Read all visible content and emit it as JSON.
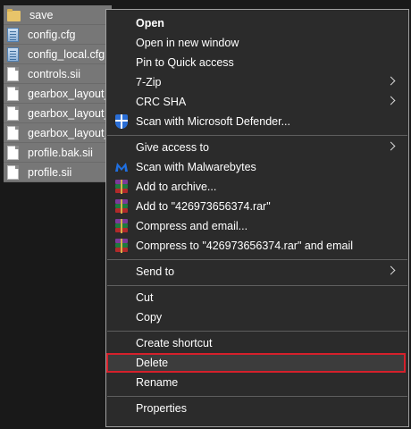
{
  "files": [
    {
      "name": "save",
      "icon": "folder-icon"
    },
    {
      "name": "config.cfg",
      "icon": "config-file-icon"
    },
    {
      "name": "config_local.cfg",
      "icon": "config-file-icon"
    },
    {
      "name": "controls.sii",
      "icon": "document-icon"
    },
    {
      "name": "gearbox_layout_e",
      "icon": "document-icon"
    },
    {
      "name": "gearbox_layout_e",
      "icon": "document-icon"
    },
    {
      "name": "gearbox_layout_e",
      "icon": "document-icon"
    },
    {
      "name": "profile.bak.sii",
      "icon": "document-icon"
    },
    {
      "name": "profile.sii",
      "icon": "document-icon"
    }
  ],
  "menu": {
    "open": "Open",
    "open_new_window": "Open in new window",
    "pin_quick_access": "Pin to Quick access",
    "seven_zip": "7-Zip",
    "crc_sha": "CRC SHA",
    "scan_defender": "Scan with Microsoft Defender...",
    "give_access": "Give access to",
    "scan_malwarebytes": "Scan with Malwarebytes",
    "add_archive": "Add to archive...",
    "add_rar": "Add to \"426973656374.rar\"",
    "compress_email": "Compress and email...",
    "compress_rar_email": "Compress to \"426973656374.rar\" and email",
    "send_to": "Send to",
    "cut": "Cut",
    "copy": "Copy",
    "create_shortcut": "Create shortcut",
    "delete": "Delete",
    "rename": "Rename",
    "properties": "Properties"
  },
  "colors": {
    "menu_bg": "#2b2b2b",
    "selection_bg": "#777777",
    "highlight_border": "#d5202b",
    "defender": "#2a6ed6",
    "malwarebytes": "#1f6fe0"
  }
}
